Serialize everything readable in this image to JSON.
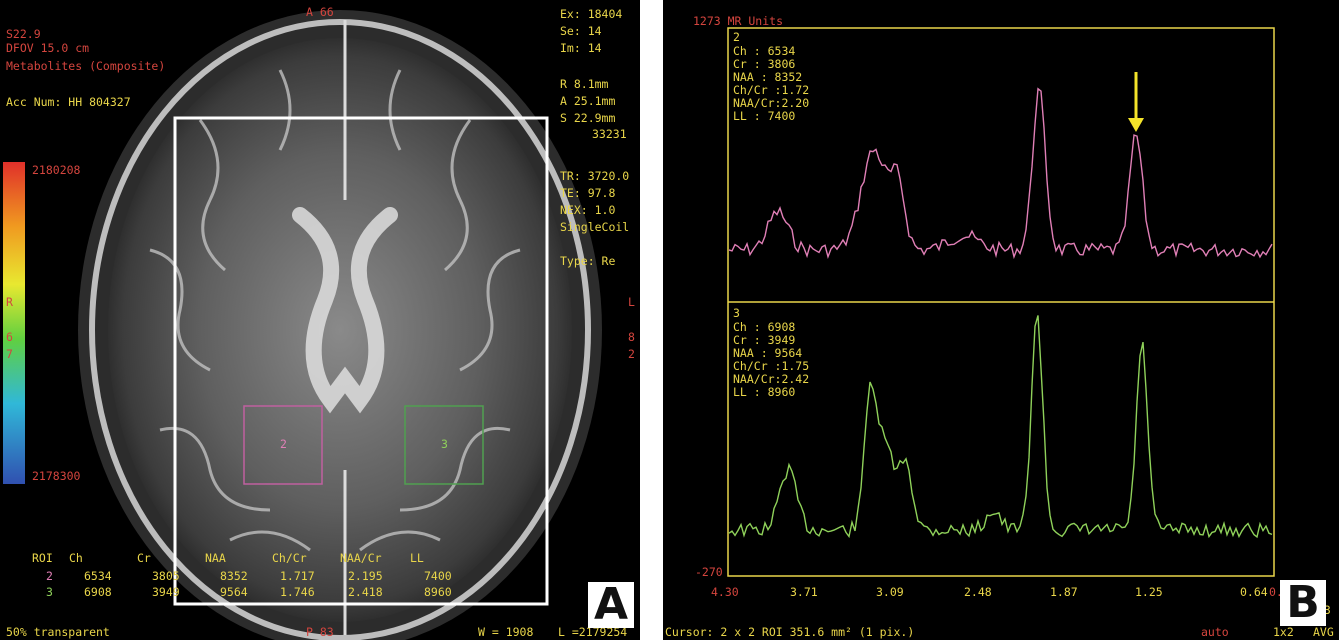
{
  "panel_a": {
    "top_center": "A 66",
    "top_left": [
      "S22.9",
      "DFOV 15.0 cm",
      "Metabolites (Composite)"
    ],
    "acc_num": "Acc Num: HH 804327",
    "top_right": [
      "Ex: 18404",
      "Se: 14",
      "Im: 14"
    ],
    "position": [
      "R   8.1mm",
      "A  25.1mm",
      "S  22.9mm",
      "33231"
    ],
    "acq": [
      "TR: 3720.0",
      "TE: 97.8",
      "NEX: 1.0",
      "SingleCoil"
    ],
    "type": "Type: Re",
    "colorbar_max": "2180208",
    "colorbar_min": "2178300",
    "colorbar_side": [
      "R",
      "6",
      "7"
    ],
    "right_edge": [
      "L",
      "8",
      "2"
    ],
    "roi_boxes": [
      {
        "label": "2",
        "color": "#c060a0"
      },
      {
        "label": "3",
        "color": "#50a050"
      }
    ],
    "table": {
      "headers": [
        "ROI",
        "Ch",
        "Cr",
        "NAA",
        "Ch/Cr",
        "NAA/Cr",
        "LL"
      ],
      "rows": [
        [
          "2",
          "6534",
          "3805",
          "8352",
          "1.717",
          "2.195",
          "7400"
        ],
        [
          "3",
          "6908",
          "3949",
          "9564",
          "1.746",
          "2.418",
          "8960"
        ]
      ]
    },
    "bottom_left": "50% transparent",
    "bottom_center": "P 83",
    "bottom_w": "W = 1908",
    "bottom_l": "L =2179254",
    "panel_letter": "A"
  },
  "panel_b": {
    "units": "1273 MR Units",
    "y_min": "-270",
    "top_spectrum": {
      "number": "2",
      "stats": [
        "Ch    : 6534",
        "Cr    : 3806",
        "NAA   : 8352",
        "Ch/Cr :1.72",
        "NAA/Cr:2.20",
        "LL    : 7400"
      ],
      "color": "#e07fb6"
    },
    "bottom_spectrum": {
      "number": "3",
      "stats": [
        "Ch    : 6908",
        "Cr    : 3949",
        "NAA   : 9564",
        "Ch/Cr :1.75",
        "NAA/Cr:2.42",
        "LL    : 8960"
      ],
      "color": "#8fd15a"
    },
    "x_ticks": [
      "4.30",
      "3.71",
      "3.09",
      "2.48",
      "1.87",
      "1.25",
      "0.64",
      "0.3"
    ],
    "right_fragment": [
      "m",
      "03"
    ],
    "status": {
      "cursor": "Cursor: 2 x 2  ROI 351.6 mm² (1 pix.)",
      "auto": "auto",
      "layout": "1x2",
      "avg": "AVG"
    },
    "arrow_color": "#f4e42a",
    "panel_letter": "B"
  }
}
